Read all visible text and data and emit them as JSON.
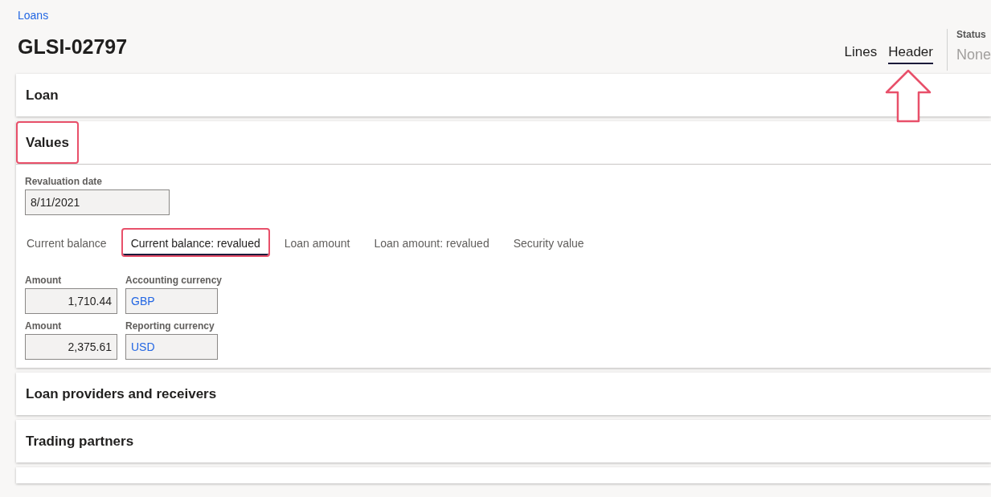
{
  "breadcrumb": "Loans",
  "title": "GLSI-02797",
  "view_tabs": [
    {
      "label": "Lines",
      "selected": false,
      "arrow": false
    },
    {
      "label": "Header",
      "selected": true,
      "arrow": true
    }
  ],
  "status": {
    "label": "Status",
    "value": "None"
  },
  "sections": [
    {
      "title": "Loan",
      "expanded": false,
      "highlighted": false
    },
    {
      "title": "Values",
      "expanded": true,
      "highlighted": true
    },
    {
      "title": "Loan providers and receivers",
      "expanded": false,
      "highlighted": false
    },
    {
      "title": "Trading partners",
      "expanded": false,
      "highlighted": false
    }
  ],
  "values": {
    "revaluation_date": {
      "label": "Revaluation date",
      "value": "8/11/2021"
    },
    "tabs": [
      {
        "label": "Current balance",
        "selected": false,
        "highlighted": false
      },
      {
        "label": "Current balance: revalued",
        "selected": true,
        "highlighted": true
      },
      {
        "label": "Loan amount",
        "selected": false,
        "highlighted": false
      },
      {
        "label": "Loan amount: revalued",
        "selected": false,
        "highlighted": false
      },
      {
        "label": "Security value",
        "selected": false,
        "highlighted": false
      }
    ],
    "rows": [
      {
        "amount_label": "Amount",
        "amount": "1,710.44",
        "currency_label": "Accounting currency",
        "currency": "GBP"
      },
      {
        "amount_label": "Amount",
        "amount": "2,375.61",
        "currency_label": "Reporting currency",
        "currency": "USD"
      }
    ]
  }
}
